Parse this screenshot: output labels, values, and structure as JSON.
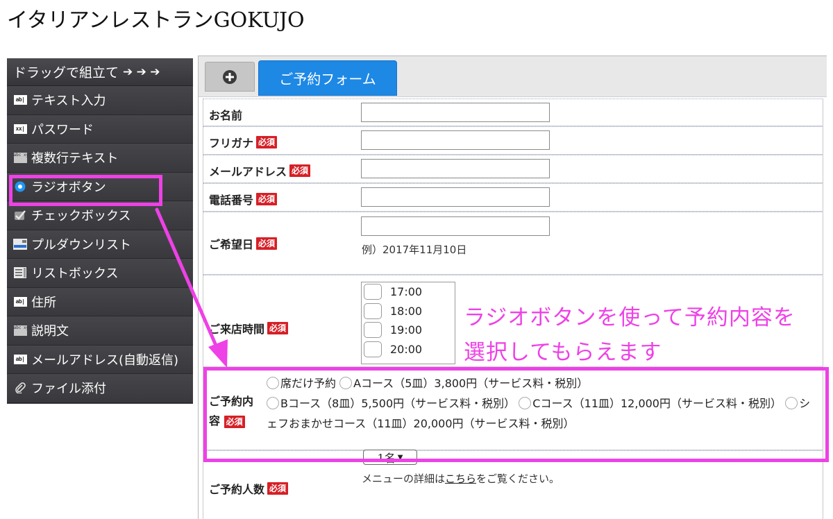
{
  "page_title": "イタリアンレストランGOKUJO",
  "sidebar": {
    "header": "ドラッグで組立て",
    "header_arrows": "➔ ➔ ➔",
    "items": [
      {
        "label": "テキスト入力",
        "icon": "text-input-icon",
        "icon_text": "ab|"
      },
      {
        "label": "パスワード",
        "icon": "password-icon",
        "icon_text": "xx|"
      },
      {
        "label": "複数行テキスト",
        "icon": "textarea-icon",
        "icon_text": "abc xyz"
      },
      {
        "label": "ラジオボタン",
        "icon": "radio-icon"
      },
      {
        "label": "チェックボックス",
        "icon": "checkbox-icon"
      },
      {
        "label": "プルダウンリスト",
        "icon": "dropdown-icon"
      },
      {
        "label": "リストボックス",
        "icon": "listbox-icon"
      },
      {
        "label": "住所",
        "icon": "address-icon",
        "icon_text": "ab|"
      },
      {
        "label": "説明文",
        "icon": "description-icon",
        "icon_text": "abc xyz"
      },
      {
        "label": "メールアドレス(自動返信)",
        "icon": "email-autoreply-icon",
        "icon_text": "ab|"
      },
      {
        "label": "ファイル添付",
        "icon": "paperclip-icon"
      }
    ]
  },
  "tabs": {
    "active_label": "ご予約フォーム"
  },
  "required_badge": "必須",
  "form": {
    "name_label": "お名前",
    "furigana_label": "フリガナ",
    "email_label": "メールアドレス",
    "phone_label": "電話番号",
    "date_label": "ご希望日",
    "date_hint": "例）2017年11月10日",
    "time_label": "ご来店時間",
    "time_options": [
      "17:00",
      "18:00",
      "19:00",
      "20:00"
    ],
    "course_label": "ご予約内容",
    "course_options": [
      "席だけ予約",
      "Aコース（5皿）3,800円（サービス料・税別）",
      "Bコース（8皿）5,500円（サービス料・税別）",
      "Cコース（11皿）12,000円（サービス料・税別）",
      "シェフおまかせコース（11皿）20,000円（サービス料・税別）"
    ],
    "party_label": "ご予約人数",
    "party_value": "1名",
    "menu_note_before": "メニューの詳細は",
    "menu_note_link": "こちら",
    "menu_note_after": "をご覧ください。"
  },
  "annotation": {
    "line1": "ラジオボタンを使って予約内容を",
    "line2": "選択してもらえます"
  },
  "colors": {
    "highlight": "#ee41e6",
    "tab_active": "#1e88e5",
    "required": "#d61f26",
    "sidebar_bg": "#3c3c40"
  }
}
